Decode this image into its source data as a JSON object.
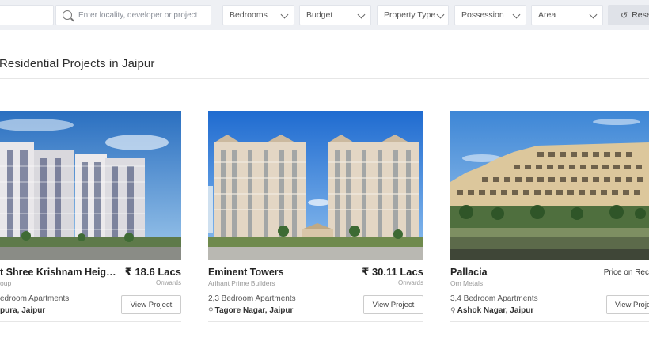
{
  "filters": {
    "search_placeholder": "Enter locality, developer or project",
    "bedrooms": "Bedrooms",
    "budget": "Budget",
    "property_type": "Property Type",
    "possession": "Possession",
    "area": "Area",
    "reset": "Rese",
    "reset_icon": "↺"
  },
  "heading": "Residential Projects in Jaipur",
  "cards": [
    {
      "name": "t Shree Krishnam Heig…",
      "builder": "oup",
      "price": "₹ 18.6 Lacs",
      "onwards": "Onwards",
      "config": "edroom Apartments",
      "location": "pura, Jaipur",
      "button": "View Project"
    },
    {
      "name": "Eminent Towers",
      "builder": "Arihant Prime Builders",
      "price": "₹ 30.11 Lacs",
      "onwards": "Onwards",
      "config": "2,3 Bedroom Apartments",
      "location": "Tagore Nagar, Jaipur",
      "button": "View Project"
    },
    {
      "name": "Pallacia",
      "builder": "Om Metals",
      "price": "Price on Rec",
      "onwards": "",
      "config": "3,4 Bedroom Apartments",
      "location": "Ashok Nagar, Jaipur",
      "button": "View Proje"
    }
  ],
  "pin_icon": "⚲"
}
